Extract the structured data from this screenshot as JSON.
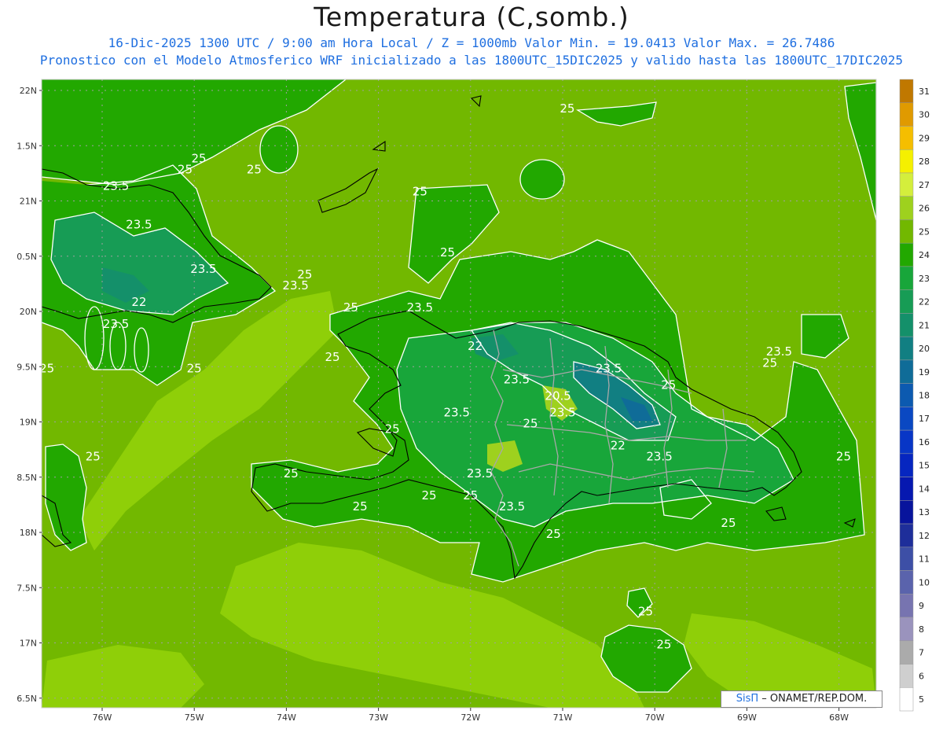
{
  "header": {
    "title": "Temperatura (C,somb.)",
    "line1": "16-Dic-2025  1300 UTC / 9:00 am Hora Local / Z = 1000mb   Valor Min. = 19.0413  Valor Max. = 26.7486",
    "line2": "Pronostico con el Modelo Atmosferico WRF inicializado a las 1800UTC_15DIC2025 y valido hasta las  1800UTC_17DIC2025"
  },
  "credit": {
    "brand": "SisΠ",
    "text": "– ONAMET/REP.DOM."
  },
  "axes": {
    "lat_labels": [
      "22N",
      "1.5N",
      "21N",
      "0.5N",
      "20N",
      "9.5N",
      "19N",
      "8.5N",
      "18N",
      "7.5N",
      "17N",
      "6.5N"
    ],
    "lon_labels": [
      "76W",
      "75W",
      "74W",
      "73W",
      "72W",
      "71W",
      "70W",
      "69W",
      "68W"
    ]
  },
  "colorbar": {
    "labels": [
      "31",
      "30",
      "29",
      "28",
      "27",
      "26",
      "25",
      "24",
      "23",
      "22",
      "21",
      "20",
      "19",
      "18",
      "17",
      "16",
      "15",
      "14",
      "13",
      "12",
      "11",
      "10",
      "9",
      "8",
      "7",
      "6",
      "5"
    ],
    "colors": [
      "#c07800",
      "#e09a00",
      "#f5be00",
      "#f5f000",
      "#d4ee3c",
      "#9ed11e",
      "#72b800",
      "#22a800",
      "#18a63a",
      "#179c55",
      "#14906a",
      "#117f82",
      "#0f6c98",
      "#0c5ab0",
      "#0a48c2",
      "#0836c6",
      "#0626c0",
      "#0618b0",
      "#08149c",
      "#1e2e9a",
      "#3d4fa6",
      "#5a63ac",
      "#7774b0",
      "#9a93bd",
      "#ababab",
      "#cfcfcf",
      "#ffffff"
    ]
  },
  "contour_labels": [
    {
      "text": "25",
      "lon": -74.95,
      "lat": 21.35
    },
    {
      "text": "25",
      "lon": -75.1,
      "lat": 21.25
    },
    {
      "text": "23.5",
      "lon": -75.85,
      "lat": 21.1
    },
    {
      "text": "23.5",
      "lon": -75.6,
      "lat": 20.75
    },
    {
      "text": "23.5",
      "lon": -74.9,
      "lat": 20.35
    },
    {
      "text": "25",
      "lon": -73.8,
      "lat": 20.3
    },
    {
      "text": "23.5",
      "lon": -73.9,
      "lat": 20.2
    },
    {
      "text": "22",
      "lon": -75.6,
      "lat": 20.05
    },
    {
      "text": "23.5",
      "lon": -75.85,
      "lat": 19.85
    },
    {
      "text": "25",
      "lon": -76.6,
      "lat": 19.45
    },
    {
      "text": "25",
      "lon": -75.0,
      "lat": 19.45
    },
    {
      "text": "25",
      "lon": -74.35,
      "lat": 21.25
    },
    {
      "text": "25",
      "lon": -72.55,
      "lat": 21.05
    },
    {
      "text": "25",
      "lon": -70.95,
      "lat": 21.8
    },
    {
      "text": "25",
      "lon": -72.25,
      "lat": 20.5
    },
    {
      "text": "23.5",
      "lon": -72.55,
      "lat": 20.0
    },
    {
      "text": "25",
      "lon": -73.3,
      "lat": 20.0
    },
    {
      "text": "25",
      "lon": -73.5,
      "lat": 19.55
    },
    {
      "text": "22",
      "lon": -71.95,
      "lat": 19.65
    },
    {
      "text": "23.5",
      "lon": -71.5,
      "lat": 19.35
    },
    {
      "text": "23.5",
      "lon": -70.5,
      "lat": 19.45
    },
    {
      "text": "20.5",
      "lon": -71.05,
      "lat": 19.2
    },
    {
      "text": "23.5",
      "lon": -71.0,
      "lat": 19.05
    },
    {
      "text": "23.5",
      "lon": -72.15,
      "lat": 19.05
    },
    {
      "text": "25",
      "lon": -71.35,
      "lat": 18.95
    },
    {
      "text": "25",
      "lon": -72.85,
      "lat": 18.9
    },
    {
      "text": "22",
      "lon": -70.4,
      "lat": 18.75
    },
    {
      "text": "23.5",
      "lon": -69.95,
      "lat": 18.65
    },
    {
      "text": "25",
      "lon": -69.85,
      "lat": 19.3
    },
    {
      "text": "25",
      "lon": -68.75,
      "lat": 19.5
    },
    {
      "text": "23.5",
      "lon": -68.65,
      "lat": 19.6
    },
    {
      "text": "25",
      "lon": -67.95,
      "lat": 18.65
    },
    {
      "text": "25",
      "lon": -76.1,
      "lat": 18.65
    },
    {
      "text": "25",
      "lon": -73.95,
      "lat": 18.5
    },
    {
      "text": "23.5",
      "lon": -71.9,
      "lat": 18.5
    },
    {
      "text": "25",
      "lon": -72.45,
      "lat": 18.3
    },
    {
      "text": "25",
      "lon": -73.2,
      "lat": 18.2
    },
    {
      "text": "25",
      "lon": -72.0,
      "lat": 18.3
    },
    {
      "text": "23.5",
      "lon": -71.55,
      "lat": 18.2
    },
    {
      "text": "25",
      "lon": -71.1,
      "lat": 17.95
    },
    {
      "text": "25",
      "lon": -69.2,
      "lat": 18.05
    },
    {
      "text": "25",
      "lon": -70.1,
      "lat": 17.25
    },
    {
      "text": "25",
      "lon": -69.9,
      "lat": 16.95
    }
  ]
}
